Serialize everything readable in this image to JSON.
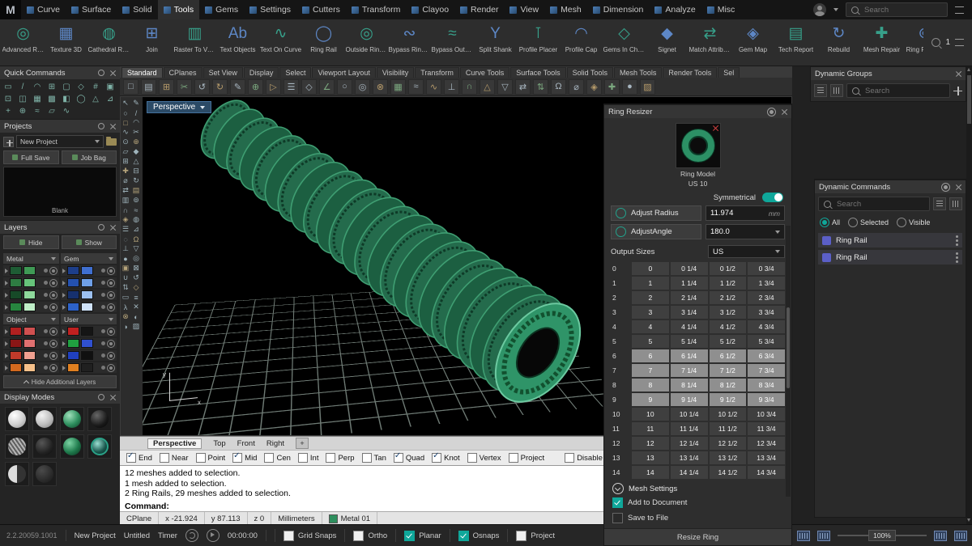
{
  "app": {
    "logo": "M"
  },
  "menubar": {
    "items": [
      "Curve",
      "Surface",
      "Solid",
      "Tools",
      "Gems",
      "Settings",
      "Cutters",
      "Transform",
      "Clayoo",
      "Render",
      "View",
      "Mesh",
      "Dimension",
      "Analyze",
      "Misc"
    ],
    "active": "Tools",
    "search_placeholder": "Search"
  },
  "toolbar": {
    "badge": "1",
    "items": [
      {
        "label": "Advanced Ring Rail",
        "icon": "◎"
      },
      {
        "label": "Texture 3D",
        "icon": "▦"
      },
      {
        "label": "Cathedral Ring Rail",
        "icon": "◍"
      },
      {
        "label": "Join",
        "icon": "⊞"
      },
      {
        "label": "Raster To Vector",
        "icon": "▥"
      },
      {
        "label": "Text Objects",
        "icon": "Ab"
      },
      {
        "label": "Text On Curve",
        "icon": "∿"
      },
      {
        "label": "Ring Rail",
        "icon": "◯"
      },
      {
        "label": "Outside Ring Rail",
        "icon": "◎"
      },
      {
        "label": "Bypass Ring Rail",
        "icon": "∾"
      },
      {
        "label": "Bypass Outside Rin...",
        "icon": "≈"
      },
      {
        "label": "Split Shank",
        "icon": "Y"
      },
      {
        "label": "Profile Placer",
        "icon": "⊺"
      },
      {
        "label": "Profile Cap",
        "icon": "◠"
      },
      {
        "label": "Gems In Channel",
        "icon": "◇"
      },
      {
        "label": "Signet",
        "icon": "◆"
      },
      {
        "label": "Match Attributes",
        "icon": "⇄"
      },
      {
        "label": "Gem Map",
        "icon": "◈"
      },
      {
        "label": "Tech Report",
        "icon": "▤"
      },
      {
        "label": "Rebuild",
        "icon": "↻"
      },
      {
        "label": "Mesh Repair",
        "icon": "✚"
      },
      {
        "label": "Ring Resizer",
        "icon": "⊚"
      }
    ]
  },
  "left": {
    "quick_commands": {
      "title": "Quick Commands",
      "glyphs": [
        "▭",
        "/",
        "◠",
        "⊞",
        "▢",
        "◇",
        "#",
        "▣",
        "⊡",
        "◫",
        "▦",
        "▩",
        "◧",
        "◯",
        "△",
        "⊿",
        "+",
        "⊕",
        "≈",
        "▱",
        "∿"
      ]
    },
    "projects": {
      "title": "Projects",
      "new_label": "New Project",
      "full_save": "Full Save",
      "job_bag": "Job Bag",
      "thumb_label": "Blank"
    },
    "layers": {
      "title": "Layers",
      "hide": "Hide",
      "show": "Show",
      "tab_metal": "Metal",
      "tab_gem": "Gem",
      "tab_object": "Object",
      "tab_user": "User",
      "metal_rows": [
        [
          "#1e5c34",
          "#3f9a55"
        ],
        [
          "#2e7d42",
          "#66c47a"
        ],
        [
          "#174a28",
          "#8ed99c"
        ],
        [
          "#27863f",
          "#bfeec7"
        ]
      ],
      "gem_rows": [
        [
          "#1d3e8a",
          "#3f6fd0"
        ],
        [
          "#2451b0",
          "#6fa0e8"
        ],
        [
          "#16306e",
          "#9cc0f0"
        ],
        [
          "#2d62c8",
          "#cfe2fa"
        ]
      ],
      "object_rows": [
        [
          "#b02020",
          "#d05050"
        ],
        [
          "#8a1616",
          "#e07070"
        ],
        [
          "#c03a2a",
          "#f0a090"
        ],
        [
          "#d2691e",
          "#f5c08a"
        ]
      ],
      "user_rows": [
        [
          "#c02020",
          "#151515"
        ],
        [
          "#20a040",
          "#3050d0"
        ],
        [
          "#2040c0",
          "#101010"
        ],
        [
          "#e08020",
          "#202020"
        ]
      ],
      "hide_additional": "Hide Additional Layers"
    },
    "display_modes": {
      "title": "Display Modes"
    }
  },
  "rhino": {
    "tabs": [
      "Standard",
      "CPlanes",
      "Set View",
      "Display",
      "Select",
      "Viewport Layout",
      "Visibility",
      "Transform",
      "Curve Tools",
      "Surface Tools",
      "Solid Tools",
      "Mesh Tools",
      "Render Tools",
      "Sel"
    ],
    "active_tab": "Standard",
    "toolbar_glyphs": [
      "□",
      "▤",
      "⊞",
      "✂",
      "↺",
      "↻",
      "✎",
      "⊕",
      "▷",
      "☰",
      "◇",
      "∠",
      "○",
      "◎",
      "⊗",
      "▦",
      "≈",
      "∿",
      "⊥",
      "∩",
      "△",
      "▽",
      "⇄",
      "⇅",
      "Ω",
      "⌀",
      "◈",
      "✚",
      "●",
      "▨"
    ]
  },
  "viewport": {
    "label": "Perspective",
    "axis_x": "x",
    "axis_y": "y",
    "left_glyphs": [
      "↖",
      "✎",
      "○",
      "/",
      "□",
      "◠",
      "∿",
      "✂",
      "⊙",
      "⊕",
      "▱",
      "◆",
      "⊞",
      "△",
      "✚",
      "⊟",
      "⌀",
      "↻",
      "⇄",
      "▤",
      "▥",
      "⊚",
      "∩",
      "≈",
      "◈",
      "◍",
      "☰",
      "⊿",
      "◌",
      "Ω",
      "⊥",
      "▽",
      "●",
      "◎",
      "▣",
      "⊠",
      "∪",
      "↺",
      "⇅",
      "◇",
      "▭",
      "≡",
      "λ",
      "✕",
      "⊗",
      "◐",
      "◑",
      "▨"
    ],
    "view_tabs": [
      "Perspective",
      "Top",
      "Front",
      "Right"
    ],
    "active_view_tab": "Perspective",
    "add_view_tab": "+",
    "osnaps": [
      {
        "label": "End",
        "checked": true
      },
      {
        "label": "Near",
        "checked": false
      },
      {
        "label": "Point",
        "checked": false
      },
      {
        "label": "Mid",
        "checked": true
      },
      {
        "label": "Cen",
        "checked": false
      },
      {
        "label": "Int",
        "checked": false
      },
      {
        "label": "Perp",
        "checked": false
      },
      {
        "label": "Tan",
        "checked": false
      },
      {
        "label": "Quad",
        "checked": true
      },
      {
        "label": "Knot",
        "checked": true
      },
      {
        "label": "Vertex",
        "checked": false
      },
      {
        "label": "Project",
        "checked": false
      },
      {
        "label": "Disable",
        "checked": false
      }
    ],
    "history": [
      "12 meshes added to selection.",
      "1 mesh added to selection.",
      "2 Ring Rails, 29 meshes added to selection."
    ],
    "command_label": "Command:",
    "status": {
      "cplane": "CPlane",
      "x": "x -21.924",
      "y": "y 87.113",
      "z": "z 0",
      "units": "Millimeters",
      "material": "Metal 01",
      "material_color": "#2e8f5e",
      "toggles": [
        {
          "label": "Grid Snap",
          "active": false
        },
        {
          "label": "Ortho",
          "active": false
        },
        {
          "label": "Planar",
          "active": true
        },
        {
          "label": "Osnap",
          "active": true
        }
      ]
    }
  },
  "ring_resizer": {
    "title": "Ring Resizer",
    "thumb_line1": "Ring Model",
    "thumb_line2": "US 10",
    "symmetrical": "Symmetrical",
    "adjust_radius": "Adjust Radius",
    "radius_value": "11.974",
    "radius_unit": "mm",
    "adjust_angle": "AdjustAngle",
    "angle_value": "180.0",
    "output_sizes": "Output Sizes",
    "units": "US",
    "highlighted_rows": [
      6,
      7,
      8,
      9
    ],
    "size_rows": [
      [
        "0",
        "0",
        "0 1/4",
        "0 1/2",
        "0 3/4"
      ],
      [
        "1",
        "1",
        "1 1/4",
        "1 1/2",
        "1 3/4"
      ],
      [
        "2",
        "2",
        "2 1/4",
        "2 1/2",
        "2 3/4"
      ],
      [
        "3",
        "3",
        "3 1/4",
        "3 1/2",
        "3 3/4"
      ],
      [
        "4",
        "4",
        "4 1/4",
        "4 1/2",
        "4 3/4"
      ],
      [
        "5",
        "5",
        "5 1/4",
        "5 1/2",
        "5 3/4"
      ],
      [
        "6",
        "6",
        "6 1/4",
        "6 1/2",
        "6 3/4"
      ],
      [
        "7",
        "7",
        "7 1/4",
        "7 1/2",
        "7 3/4"
      ],
      [
        "8",
        "8",
        "8 1/4",
        "8 1/2",
        "8 3/4"
      ],
      [
        "9",
        "9",
        "9 1/4",
        "9 1/2",
        "9 3/4"
      ],
      [
        "10",
        "10",
        "10 1/4",
        "10 1/2",
        "10 3/4"
      ],
      [
        "11",
        "11",
        "11 1/4",
        "11 1/2",
        "11 3/4"
      ],
      [
        "12",
        "12",
        "12 1/4",
        "12 1/2",
        "12 3/4"
      ],
      [
        "13",
        "13",
        "13 1/4",
        "13 1/2",
        "13 3/4"
      ],
      [
        "14",
        "14",
        "14 1/4",
        "14 1/2",
        "14 3/4"
      ]
    ],
    "mesh_settings": "Mesh Settings",
    "add_to_document": "Add to Document",
    "add_to_document_checked": true,
    "save_to_file": "Save to File",
    "save_to_file_checked": false,
    "resize_button": "Resize Ring"
  },
  "dynamic_groups": {
    "title": "Dynamic Groups",
    "search_placeholder": "Search"
  },
  "dynamic_commands": {
    "title": "Dynamic Commands",
    "search_placeholder": "Search",
    "filters": [
      {
        "label": "All",
        "selected": true
      },
      {
        "label": "Selected",
        "selected": false
      },
      {
        "label": "Visible",
        "selected": false
      }
    ],
    "items": [
      "Ring Rail",
      "Ring Rail"
    ],
    "item_color": "#5b5fc7"
  },
  "bottombar": {
    "version": "2.2.20059.1001",
    "project": "New Project",
    "file": "Untitled",
    "timer": "Timer",
    "time": "00:00:00",
    "toggles": [
      {
        "label": "Grid Snaps",
        "checked": false
      },
      {
        "label": "Ortho",
        "checked": false
      },
      {
        "label": "Planar",
        "checked": true
      },
      {
        "label": "Osnaps",
        "checked": true
      },
      {
        "label": "Project",
        "checked": false
      }
    ],
    "zoom": "100%"
  }
}
